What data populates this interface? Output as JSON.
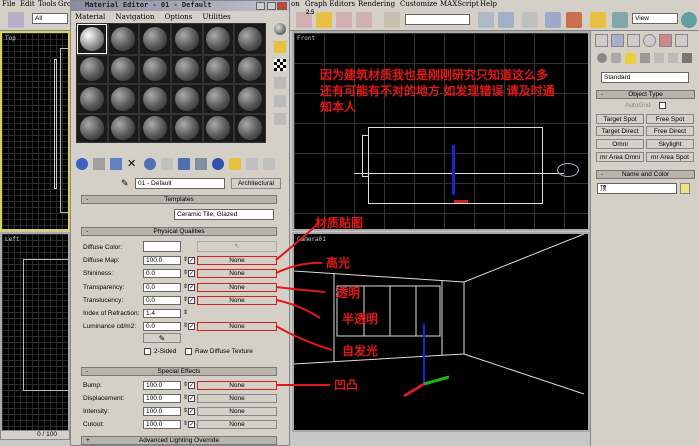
{
  "menubar": {
    "left_items": [
      "File",
      "Edit",
      "Tools",
      "Group"
    ],
    "right_items": [
      "on",
      "Graph Editors",
      "Rendering",
      "Customize",
      "MAXScript",
      "Help"
    ]
  },
  "toolbar": {
    "selection_filter": "All",
    "snap_value": "2.5",
    "view_dropdown": "View"
  },
  "viewports": {
    "top": "Top",
    "left": "Left",
    "front": "Front",
    "camera": "Camera01"
  },
  "timeline": {
    "frame": "0 / 100"
  },
  "material_editor": {
    "title": "Material Editor - 01 - Default",
    "menu": [
      "Material",
      "Navigation",
      "Options",
      "Utilities"
    ],
    "material_name": "01 - Default",
    "material_type": "Architectural",
    "templates": {
      "header": "Templates",
      "value": "Ceramic Tile, Glazed"
    },
    "physical": {
      "header": "Physical Qualities",
      "diffuse_color_label": "Diffuse Color:",
      "rows": [
        {
          "label": "Diffuse Map:",
          "value": "100.0",
          "map": "None"
        },
        {
          "label": "Shininess:",
          "value": "0.0",
          "map": "None"
        },
        {
          "label": "Transparency:",
          "value": "0.0",
          "map": "None"
        },
        {
          "label": "Translucency:",
          "value": "0.0",
          "map": "None"
        },
        {
          "label": "Index of Refraction:",
          "value": "1.4"
        },
        {
          "label": "Luminance cd/m2:",
          "value": "0.0",
          "map": "None"
        }
      ],
      "two_sided": "2-Sided",
      "raw_diffuse": "Raw Diffuse Texture"
    },
    "special": {
      "header": "Special Effects",
      "rows": [
        {
          "label": "Bump:",
          "value": "100.0",
          "map": "None"
        },
        {
          "label": "Displacement:",
          "value": "100.0",
          "map": "None"
        },
        {
          "label": "Intensity:",
          "value": "100.0",
          "map": "None"
        },
        {
          "label": "Cutout:",
          "value": "100.0",
          "map": "None"
        }
      ]
    },
    "advanced_lighting": "Advanced Lighting Override"
  },
  "annotations": {
    "note": "因为建筑材质我也是刚刚研究只知道这么多 还有可能有不对的地方 如发现错误 请及时通知本人",
    "diffuse_map": "材质贴图",
    "shininess": "高光",
    "transparency": "透明",
    "translucency": "半透明",
    "luminance": "自发光",
    "bump": "凹凸",
    "color": "#e01818"
  },
  "command_panel": {
    "category": "Standard",
    "object_type_header": "Object Type",
    "autogrid": "AutoGrid",
    "buttons": [
      "Target Spot",
      "Free Spot",
      "Target Direct",
      "Free Direct",
      "Omni",
      "Skylight",
      "mr Area Omni",
      "mr Area Spot"
    ],
    "name_color_header": "Name and Color",
    "name_value": "顶"
  }
}
